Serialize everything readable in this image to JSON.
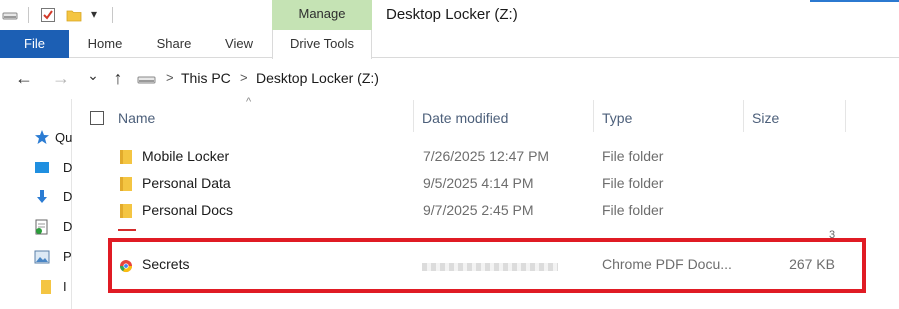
{
  "window": {
    "title": "Desktop Locker (Z:)",
    "contextual_tab": "Manage",
    "qat_dropdown": "▾"
  },
  "ribbon": {
    "tabs": [
      "File",
      "Home",
      "Share",
      "View",
      "Drive Tools"
    ]
  },
  "address": {
    "back": "←",
    "forward": "→",
    "recent": "⌄",
    "up": "↑",
    "separator": ">",
    "crumbs": [
      "This PC",
      "Desktop Locker (Z:)"
    ]
  },
  "nav_pane": {
    "items": [
      {
        "label": "Qu",
        "icon": "star-icon"
      },
      {
        "label": "D",
        "icon": "desktop-icon"
      },
      {
        "label": "D",
        "icon": "downloads-icon"
      },
      {
        "label": "D",
        "icon": "documents-icon"
      },
      {
        "label": "P",
        "icon": "pictures-icon"
      },
      {
        "label": "I",
        "icon": "folder-icon"
      }
    ]
  },
  "columns": {
    "name": "Name",
    "date": "Date modified",
    "type": "Type",
    "size": "Size",
    "sort_caret": "^"
  },
  "rows": [
    {
      "name": "Mobile Locker",
      "date": "7/26/2025 12:47 PM",
      "type": "File folder",
      "size": "",
      "icon": "folder-icon"
    },
    {
      "name": "Personal Data",
      "date": "9/5/2025 4:14 PM",
      "type": "File folder",
      "size": "",
      "icon": "folder-icon"
    },
    {
      "name": "Personal Docs",
      "date": "9/7/2025 2:45 PM",
      "type": "File folder",
      "size": "",
      "icon": "folder-icon"
    },
    {
      "name": "Secrets",
      "date": "",
      "type": "Chrome PDF Docu...",
      "size": "267 KB",
      "icon": "chrome-pdf-icon"
    }
  ],
  "partial_row_mark": "3",
  "colors": {
    "file_tab": "#1c5fb4",
    "manage_tab": "#c5e3b4",
    "highlight_box": "#e01b24",
    "folder": "#f4c542"
  }
}
